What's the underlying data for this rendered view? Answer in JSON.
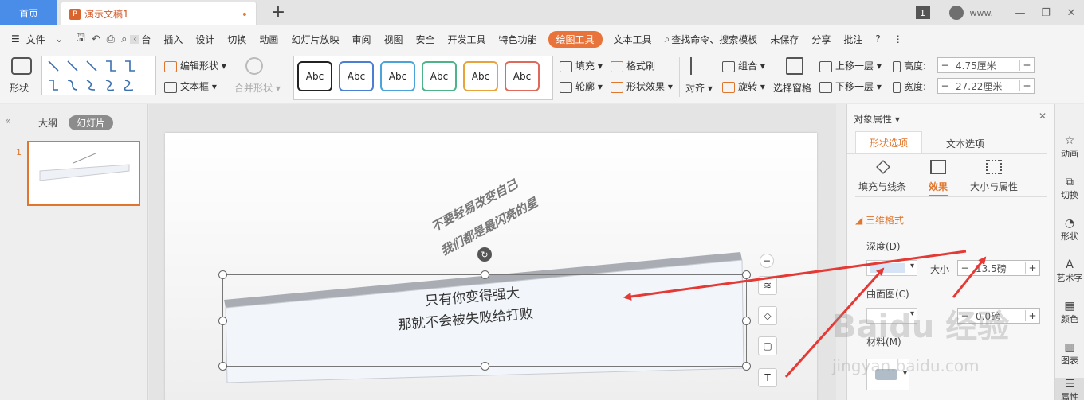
{
  "titlebar": {
    "home_tab": "首页",
    "doc_tab": "演示文稿1",
    "doc_icon": "P",
    "modified_dot": "•",
    "add_tab": "+",
    "badge": "1",
    "user": "www."
  },
  "menubar": {
    "file": "文件",
    "items": [
      "台",
      "插入",
      "设计",
      "切换",
      "动画",
      "幻灯片放映",
      "审阅",
      "视图",
      "安全",
      "开发工具",
      "特色功能"
    ],
    "active": "绘图工具",
    "text_tools": "文本工具",
    "search": "查找命令、搜索模板",
    "unsaved": "未保存",
    "share": "分享",
    "comment": "批注"
  },
  "ribbon": {
    "shape": "形状",
    "edit_shape": "编辑形状",
    "text_box": "文本框",
    "merge_shape": "合并形状",
    "abc_styles": [
      "Abc",
      "Abc",
      "Abc",
      "Abc",
      "Abc",
      "Abc"
    ],
    "abc_colors": [
      "#222222",
      "#4a7fd4",
      "#4aa3d9",
      "#4fb38a",
      "#e8a33b",
      "#e06a5a"
    ],
    "fill": "填充",
    "format_brush": "格式刷",
    "outline": "轮廓",
    "shape_effect": "形状效果",
    "align": "对齐",
    "group": "组合",
    "rotate": "旋转",
    "selection_pane": "选择窗格",
    "bring_forward": "上移一层",
    "send_backward": "下移一层",
    "height_label": "高度:",
    "height_value": "4.75厘米",
    "width_label": "宽度:",
    "width_value": "27.22厘米"
  },
  "leftpanel": {
    "outline_tab": "大纲",
    "slides_tab": "幻灯片",
    "slide_number": "1"
  },
  "slide": {
    "back_text_line1": "不要轻易改变自己",
    "back_text_line2": "我们都是最闪亮的星",
    "box_text_line1": "只有你变得强大",
    "box_text_line2": "那就不会被失败给打败"
  },
  "rightpanel": {
    "title": "对象属性",
    "tab_shape": "形状选项",
    "tab_text": "文本选项",
    "sub_fill": "填充与线条",
    "sub_effect": "效果",
    "sub_size": "大小与属性",
    "section": "三维格式",
    "depth_label": "深度(D)",
    "size_label": "大小",
    "depth_size_value": "13.5磅",
    "contour_label": "曲面图(C)",
    "contour_value": "0.0磅",
    "material_label": "材料(M)"
  },
  "sidebar": {
    "items": [
      "动画",
      "切换",
      "形状",
      "艺术字",
      "颜色",
      "图表",
      "属性"
    ]
  },
  "watermark": {
    "line1": "Baidu 经验",
    "line2": "jingyan.baidu.com"
  },
  "colors": {
    "accent": "#e8743b",
    "home_tab": "#4a8de8",
    "arrow": "#e53935"
  }
}
